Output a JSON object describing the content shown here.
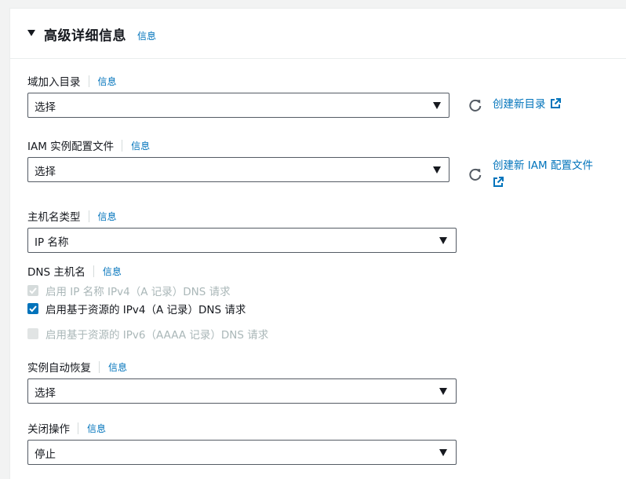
{
  "section": {
    "title": "高级详细信息",
    "info": "信息"
  },
  "domain_join": {
    "label": "域加入目录",
    "info": "信息",
    "value": "选择",
    "create_link": "创建新目录"
  },
  "iam_profile": {
    "label": "IAM 实例配置文件",
    "info": "信息",
    "value": "选择",
    "create_link_line1": "创建新 IAM 配置文件"
  },
  "hostname_type": {
    "label": "主机名类型",
    "info": "信息",
    "value": "IP 名称"
  },
  "dns_hostname": {
    "label": "DNS 主机名",
    "info": "信息",
    "options": [
      {
        "label": "启用 IP 名称 IPv4（A 记录）DNS 请求",
        "checked": true,
        "disabled": true
      },
      {
        "label": "启用基于资源的 IPv4（A 记录）DNS 请求",
        "checked": true,
        "disabled": false
      },
      {
        "label": "启用基于资源的 IPv6（AAAA 记录）DNS 请求",
        "checked": false,
        "disabled": true
      }
    ]
  },
  "auto_recovery": {
    "label": "实例自动恢复",
    "info": "信息",
    "value": "选择"
  },
  "shutdown_behavior": {
    "label": "关闭操作",
    "info": "信息",
    "value": "停止"
  },
  "colors": {
    "link": "#0073bb",
    "checkbox_checked": "#0073bb",
    "checkbox_disabled": "#d5dbdb",
    "disabled_text": "#aab7b8",
    "border": "#545b64"
  },
  "icons": [
    "caret-down-icon",
    "refresh-icon",
    "external-link-icon",
    "checkmark-icon"
  ]
}
